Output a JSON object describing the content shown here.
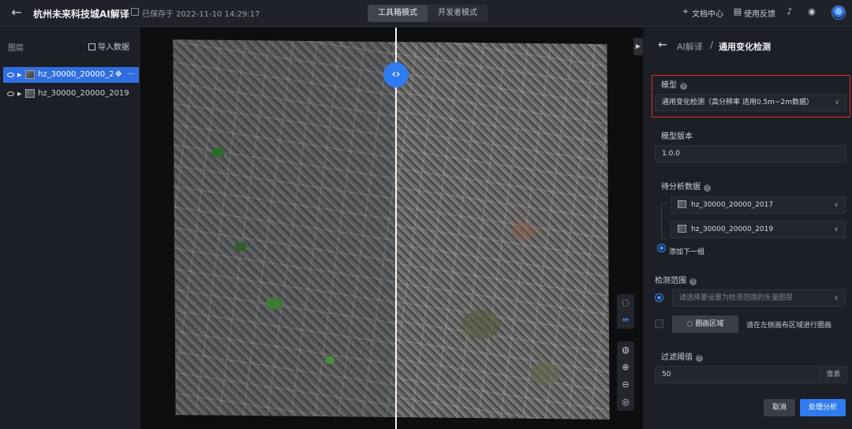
{
  "header": {
    "back_icon": "arrow-left-icon",
    "title": "杭州未来科技城AI解译",
    "save_status": "已保存于 2022-11-10 14:29:17",
    "modes": [
      {
        "label": "工具箱模式",
        "active": true
      },
      {
        "label": "开发者模式",
        "active": false
      }
    ],
    "docs_label": "文档中心",
    "feedback_label": "使用反馈"
  },
  "layers": {
    "title": "图层",
    "import_label": "导入数据",
    "items": [
      {
        "name": "hz_30000_20000_2...",
        "selected": true
      },
      {
        "name": "hz_30000_20000_2019",
        "selected": false
      }
    ]
  },
  "map": {
    "swipe_icon": "split-arrows-icon"
  },
  "panel": {
    "breadcrumb_parent": "AI解译",
    "breadcrumb_sep": "/",
    "title": "通用变化检测",
    "model_label": "模型",
    "model_value": "通用变化检测（高分辨率 适用0.5m~2m数据）",
    "version_label": "模型版本",
    "version_value": "1.0.0",
    "data_label": "待分析数据",
    "data_items": [
      "hz_30000_20000_2017",
      "hz_30000_20000_2019"
    ],
    "add_group_label": "添加下一组",
    "range_label": "检测范围",
    "range_placeholder": "请选择要设置为检测范围的矢量图层",
    "draw_button_label": "圈画区域",
    "draw_hint": "请在左侧画布区域进行圈画",
    "threshold_label": "过滤阈值",
    "threshold_value": "50",
    "threshold_unit": "像素",
    "cancel_label": "取消",
    "run_label": "处理分析"
  },
  "colors": {
    "accent": "#2f7bf0",
    "highlight": "#d9312b"
  }
}
